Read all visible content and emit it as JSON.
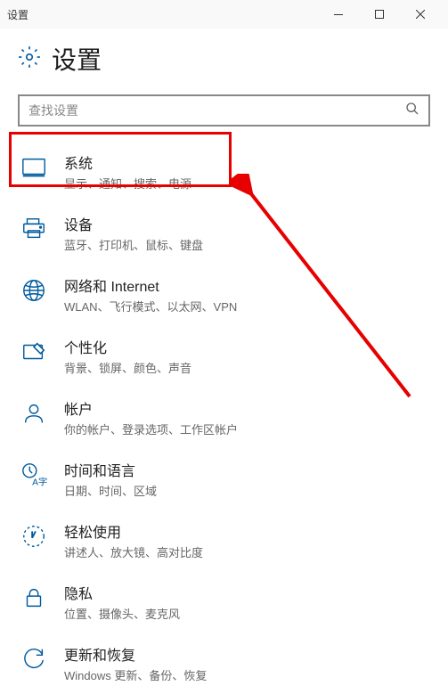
{
  "window": {
    "title": "设置"
  },
  "header": {
    "title": "设置"
  },
  "search": {
    "placeholder": "查找设置"
  },
  "items": [
    {
      "title": "系统",
      "desc": "显示、通知、搜索、电源"
    },
    {
      "title": "设备",
      "desc": "蓝牙、打印机、鼠标、键盘"
    },
    {
      "title": "网络和 Internet",
      "desc": "WLAN、飞行模式、以太网、VPN"
    },
    {
      "title": "个性化",
      "desc": "背景、锁屏、颜色、声音"
    },
    {
      "title": "帐户",
      "desc": "你的帐户、登录选项、工作区帐户"
    },
    {
      "title": "时间和语言",
      "desc": "日期、时间、区域"
    },
    {
      "title": "轻松使用",
      "desc": "讲述人、放大镜、高对比度"
    },
    {
      "title": "隐私",
      "desc": "位置、摄像头、麦克风"
    },
    {
      "title": "更新和恢复",
      "desc": "Windows 更新、备份、恢复"
    }
  ]
}
